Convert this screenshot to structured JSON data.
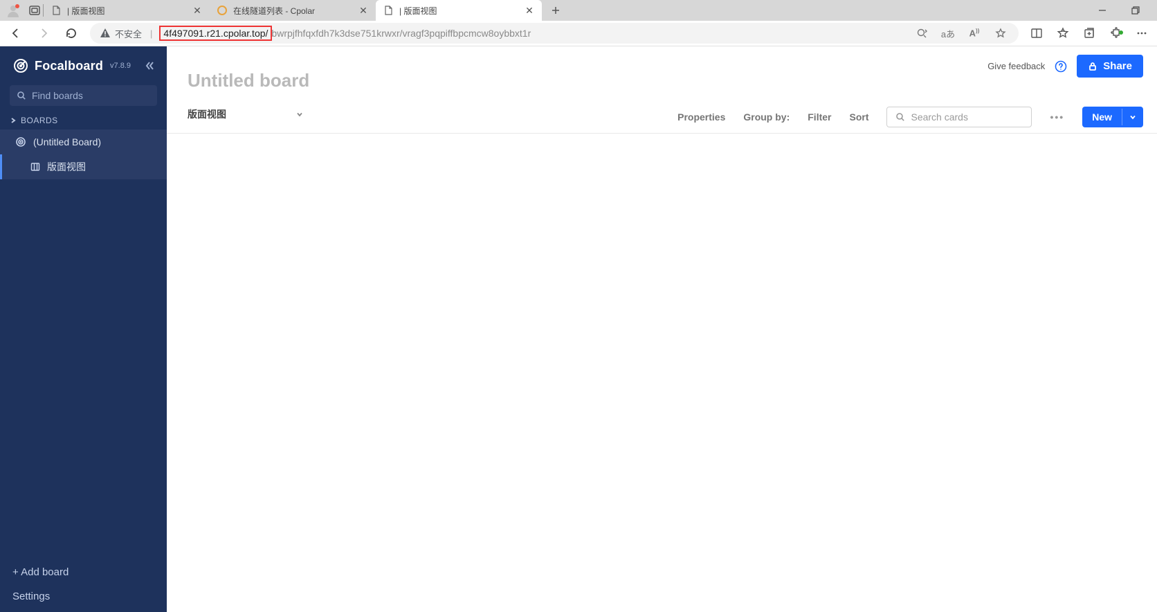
{
  "browser": {
    "tabs": [
      {
        "title": "| 版面视图"
      },
      {
        "title": "在线隧道列表 - Cpolar"
      },
      {
        "title": "| 版面视图"
      }
    ],
    "insecure_label": "不安全",
    "url_highlighted": "4f497091.r21.cpolar.top/",
    "url_rest": "bwrpjfhfqxfdh7k3dse751krwxr/vragf3pqpiffbpcmcw8oybbxt1r"
  },
  "sidebar": {
    "logo": "Focalboard",
    "version": "v7.8.9",
    "find_placeholder": "Find boards",
    "section_label": "BOARDS",
    "board_name": "(Untitled Board)",
    "view_name": "版面视图",
    "add_board": "+ Add board",
    "settings": "Settings"
  },
  "main": {
    "feedback": "Give feedback",
    "share": "Share",
    "title": "Untitled board",
    "view_name": "版面视图",
    "properties": "Properties",
    "group_by": "Group by:",
    "filter": "Filter",
    "sort": "Sort",
    "search_placeholder": "Search cards",
    "new": "New"
  }
}
